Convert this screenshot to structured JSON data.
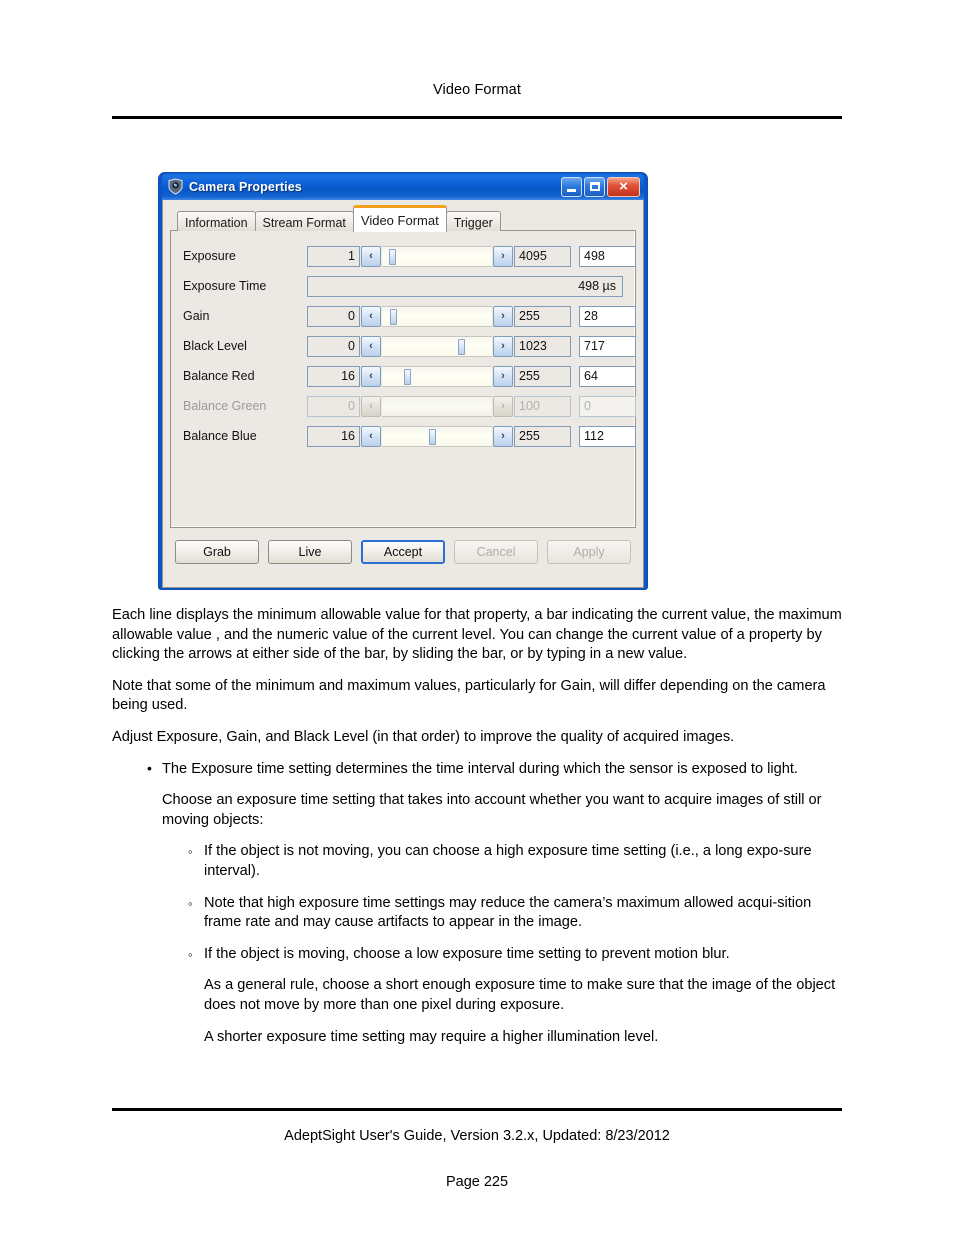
{
  "page": {
    "header_title": "Video Format",
    "footer_guide": "AdeptSight User's Guide,  Version 3.2.x, Updated: 8/23/2012",
    "footer_page": "Page 225"
  },
  "dialog": {
    "title": "Camera Properties",
    "icon": "camera-icon",
    "window_buttons": {
      "minimize": "minimize-icon",
      "maximize": "maximize-icon",
      "close": "×"
    },
    "tabs": [
      {
        "label": "Information",
        "active": false
      },
      {
        "label": "Stream Format",
        "active": false
      },
      {
        "label": "Video Format",
        "active": true
      },
      {
        "label": "Trigger",
        "active": false
      }
    ],
    "accent_color": "#f2a01e",
    "titlebar_color": "#0a55c8",
    "properties": [
      {
        "label": "Exposure",
        "min": "1",
        "max": "4095",
        "value": "498",
        "thumb_pct": 6,
        "enabled": true,
        "type": "slider"
      },
      {
        "label": "Exposure Time",
        "readonly_value": "498 µs",
        "enabled": true,
        "type": "readonly"
      },
      {
        "label": "Gain",
        "min": "0",
        "max": "255",
        "value": "28",
        "thumb_pct": 7,
        "enabled": true,
        "type": "slider"
      },
      {
        "label": "Black Level",
        "min": "0",
        "max": "1023",
        "value": "717",
        "thumb_pct": 69,
        "enabled": true,
        "type": "slider"
      },
      {
        "label": "Balance Red",
        "min": "16",
        "max": "255",
        "value": "64",
        "thumb_pct": 20,
        "enabled": true,
        "type": "slider"
      },
      {
        "label": "Balance Green",
        "min": "0",
        "max": "100",
        "value": "0",
        "thumb_pct": 0,
        "enabled": false,
        "type": "slider"
      },
      {
        "label": "Balance Blue",
        "min": "16",
        "max": "255",
        "value": "112",
        "thumb_pct": 43,
        "enabled": true,
        "type": "slider"
      }
    ],
    "buttons": [
      {
        "label": "Grab",
        "state": "normal"
      },
      {
        "label": "Live",
        "state": "normal"
      },
      {
        "label": "Accept",
        "state": "default"
      },
      {
        "label": "Cancel",
        "state": "disabled"
      },
      {
        "label": "Apply",
        "state": "disabled"
      }
    ],
    "arrows": {
      "left": "‹",
      "right": "›"
    }
  },
  "content": {
    "p1": "Each line displays the minimum allowable value for that property, a bar indicating the current value, the maximum allowable value , and the numeric value of the current level. You can change the current value of a property by clicking the arrows at either side of the bar, by sliding the bar, or by typing in a new value.",
    "p2": "Note that some of the minimum and maximum values, particularly for Gain, will differ depending on the camera being used.",
    "p3": "Adjust Exposure, Gain, and Black Level (in that order) to improve the quality of acquired images.",
    "b1": "The Exposure time setting determines the time interval during which the sensor is exposed to light.",
    "b1_follow": "Choose an exposure time setting that takes into account whether you want to acquire images of still or moving objects:",
    "s1": "If the object is not moving, you can choose a high exposure time setting (i.e., a long expo-sure interval).",
    "s2": "Note that high exposure time settings may reduce the camera’s maximum allowed acqui-sition frame rate and may cause artifacts to appear in the image.",
    "s3": "If the object is moving, choose a low exposure time setting to prevent motion blur.",
    "s3_follow1": "As a general rule, choose a short enough exposure time to make sure that the image of the object does not move by more than one pixel during exposure.",
    "s3_follow2": "A shorter exposure time setting may require a higher illumination level."
  }
}
